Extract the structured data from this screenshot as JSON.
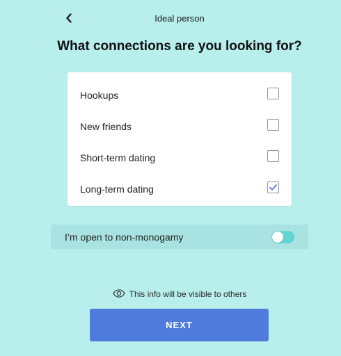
{
  "header": {
    "title": "Ideal person",
    "back_icon": "chevron-left-icon"
  },
  "question": "What connections are you looking for?",
  "options": [
    {
      "label": "Hookups",
      "checked": false
    },
    {
      "label": "New friends",
      "checked": false
    },
    {
      "label": "Short-term dating",
      "checked": false
    },
    {
      "label": "Long-term dating",
      "checked": true
    }
  ],
  "toggle": {
    "label": "I’m open to non-monogamy",
    "on": false
  },
  "visibility_note": {
    "icon": "eye-icon",
    "text": "This info will be visible to others"
  },
  "next_button": "NEXT",
  "colors": {
    "background": "#b8eeec",
    "accent": "#4f7bdc",
    "toggle_track": "#62d4d2"
  }
}
